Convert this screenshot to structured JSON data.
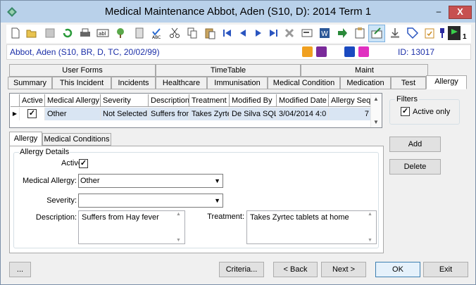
{
  "window": {
    "title": "Medical Maintenance   Abbot, Aden (S10, D): 2014 Term 1",
    "min_glyph": "‒",
    "close_glyph": "X"
  },
  "toolbar": {
    "badge_count": "1"
  },
  "patient": {
    "name": "Abbot, Aden (S10, BR, D, TC, 20/02/99)",
    "id": "ID: 13017"
  },
  "tabs_row1": [
    {
      "label": "User Forms"
    },
    {
      "label": "TimeTable"
    },
    {
      "label": "Maint"
    }
  ],
  "tabs_row2": [
    {
      "label": "Summary"
    },
    {
      "label": "This Incident"
    },
    {
      "label": "Incidents"
    },
    {
      "label": "Healthcare"
    },
    {
      "label": "Immunisation"
    },
    {
      "label": "Medical Condition"
    },
    {
      "label": "Medication"
    },
    {
      "label": "Test"
    },
    {
      "label": "Allergy"
    }
  ],
  "grid": {
    "columns": [
      "Active",
      "Medical Allergy",
      "Severity",
      "Description",
      "Treatment",
      "Modified By",
      "Modified Date",
      "Allergy Seq"
    ],
    "row": {
      "active_check": "✓",
      "medical_allergy": "Other",
      "severity": "Not Selected",
      "description": "Suffers from",
      "treatment": "Takes Zyrtec",
      "modified_by": "De Silva SQL,",
      "modified_date": "3/04/2014 4:0",
      "allergy_seq": "7"
    }
  },
  "filters": {
    "title": "Filters",
    "active_only": "Active only",
    "check": "✓"
  },
  "sub_tabs": [
    {
      "label": "Allergy"
    },
    {
      "label": "Medical Conditions"
    }
  ],
  "details": {
    "group_title": "Allergy Details",
    "active_label": "Active:",
    "active_check": "✓",
    "medical_allergy_label": "Medical Allergy:",
    "medical_allergy_value": "Other",
    "severity_label": "Severity:",
    "severity_value": "",
    "description_label": "Description:",
    "description_value": "Suffers from Hay fever",
    "treatment_label": "Treatment:",
    "treatment_value": "Takes Zyrtec tablets at home"
  },
  "buttons": {
    "add": "Add",
    "delete": "Delete",
    "more": "...",
    "criteria": "Criteria...",
    "back": "< Back",
    "next": "Next >",
    "ok": "OK",
    "exit": "Exit"
  },
  "colors": {
    "titlebar": "#b9d1ea",
    "patient_text": "#1c2fa8",
    "close": "#c75050",
    "selected_row": "#d9e5f3"
  }
}
